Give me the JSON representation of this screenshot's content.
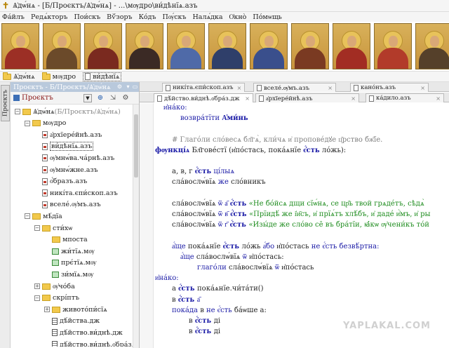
{
  "window": {
    "title": "Ѧ҆дѡ́нѧ - [Б/Проєктъ/Ѧ҆дѡ́нѧ] - ...\\мѹдро\\ви́дѣнїѧ.азъ"
  },
  "menu": [
    "Фа́йлъ",
    "Редѧ́кторъ",
    "Пои́скъ",
    "Вѷ́зоръ",
    "Ко́дъ",
    "Пѹ́скъ",
    "Налѧ́дка",
    "О҆кно̀",
    "По́мѡщь"
  ],
  "icon_strip": [
    {
      "robe": "#9c2f25"
    },
    {
      "robe": "#6b4a2a"
    },
    {
      "robe": "#7a2a1f"
    },
    {
      "robe": "#3b2a25"
    },
    {
      "robe": "#4f6aa8"
    },
    {
      "robe": "#2f3f6a"
    },
    {
      "robe": "#3a4f8c"
    },
    {
      "robe": "#7a3a22"
    },
    {
      "robe": "#a22d23"
    },
    {
      "robe": "#b23b2a"
    },
    {
      "robe": "#55402a"
    }
  ],
  "breadcrumb": [
    {
      "label": "Ѧ҆дѡ́нѧ",
      "type": "folder"
    },
    {
      "label": "мѹдро",
      "type": "folder"
    },
    {
      "label": "ви́дѣнїѧ",
      "type": "file"
    }
  ],
  "side_tab": "Проєктъ",
  "project": {
    "header": "Проєктъ - Б/Проєктъ/Ѧ҆дѡ́нѧ",
    "selector": "Проєктъ",
    "tree": [
      {
        "label": "Ѧ҆дѡ́нѧ",
        "extra": "(Б/Проєктъ/Ѧ҆дѡ́нѧ)",
        "kind": "folder",
        "toggle": "−"
      },
      {
        "label": "мѹдро",
        "kind": "folder",
        "toggle": "−"
      },
      {
        "label": "а҆рхїере́йнѣ.азъ",
        "kind": "file"
      },
      {
        "label": "ви́дѣнїѧ.азъ",
        "kind": "file",
        "selected": true
      },
      {
        "label": "ѹ҆мнѡ́ва.ча́рнѣ.азъ",
        "kind": "file"
      },
      {
        "label": "ѹ҆мнѡ́жне.азъ",
        "kind": "file"
      },
      {
        "label": "о҆́бразъ.азъ",
        "kind": "file"
      },
      {
        "label": "никі́та.єпи́скоп.азъ",
        "kind": "file"
      },
      {
        "label": "вселе́.ѹ҆мъ.азъ",
        "kind": "file"
      },
      {
        "label": "мѣ́дїа",
        "kind": "folder",
        "toggle": "−"
      },
      {
        "label": "сти́хѡ",
        "kind": "folder",
        "toggle": "−"
      },
      {
        "label": "мпоста",
        "kind": "folder"
      },
      {
        "label": "жи́тїѧ.мѹ",
        "kind": "image"
      },
      {
        "label": "прє́тїѧ.мѹ",
        "kind": "image"
      },
      {
        "label": "зи́мїѧ.мѹ",
        "kind": "image"
      },
      {
        "label": "ѹ҆чо́ба",
        "kind": "folder",
        "toggle": "+"
      },
      {
        "label": "скрі́птъ",
        "kind": "folder",
        "toggle": "−"
      },
      {
        "label": "живото́пи́сїѧ",
        "kind": "folder",
        "toggle": "+"
      },
      {
        "label": "дѣ́йства.дж",
        "kind": "doc"
      },
      {
        "label": "дѣ́йство.ви́днѣ.дж",
        "kind": "doc"
      },
      {
        "label": "дѣ́йство.ви́днѣ.о҆бра́з.дж",
        "kind": "doc"
      },
      {
        "label": "є҆вїо.дѣ́йства.дж",
        "kind": "doc"
      }
    ]
  },
  "tabs_row1": [
    {
      "label": "никі́та.єпи́скоп.азъ"
    },
    {
      "label": "вселе́.ѹ҆мъ.азъ"
    },
    {
      "label": "кано́нъ.азъ"
    }
  ],
  "tabs_row2": [
    {
      "label": "дѣ́йство.ви́днѣ.о҆бра́з.дж"
    },
    {
      "label": "а҆рхїере́йнѣ.азъ"
    },
    {
      "label": "ка́дило.азъ"
    }
  ],
  "code": [
    {
      "parts": [
        {
          "c": "kw",
          "t": "и҆на́ко:"
        }
      ],
      "indent": 2
    },
    {
      "parts": [
        {
          "c": "kw",
          "t": "возвра́тїти "
        },
        {
          "c": "kwb",
          "t": "А҆ми́нь"
        }
      ],
      "indent": 6
    },
    {
      "parts": [],
      "indent": 0
    },
    {
      "parts": [
        {
          "c": "cmt",
          "t": "# Глаго́ли сло́весѧ бл҃гѧ̀, кли́чѧ и҆ пропове́дꙋе ц҃рство бж҃їе."
        }
      ],
      "indent": 4
    },
    {
      "parts": [
        {
          "c": "kwb",
          "t": "фѹнкці́ѧ "
        },
        {
          "c": "txt",
          "t": "Бл҃гове́стї (и҆по́стась, пока́ѧнїе "
        },
        {
          "c": "kwb",
          "t": "є҆́сть"
        },
        {
          "c": "txt",
          "t": " ло́жь):"
        }
      ],
      "indent": 0
    },
    {
      "parts": [],
      "indent": 0
    },
    {
      "parts": [
        {
          "c": "txt",
          "t": "а, в, г "
        },
        {
          "c": "kwb",
          "t": "є҆́сть"
        },
        {
          "c": "kw",
          "t": " ці́лыѧ"
        }
      ],
      "indent": 4
    },
    {
      "parts": [
        {
          "c": "txt",
          "t": "сла́вослѡ́вїѧ "
        },
        {
          "c": "kw",
          "t": "же "
        },
        {
          "c": "txt",
          "t": "сло́вникъ"
        }
      ],
      "indent": 4
    },
    {
      "parts": [],
      "indent": 0
    },
    {
      "parts": [
        {
          "c": "txt",
          "t": "сла́вослѡ́вїѧ "
        },
        {
          "c": "kw",
          "t": "ѿ "
        },
        {
          "c": "num",
          "t": "а҃ "
        },
        {
          "c": "kwb",
          "t": "є҆́сть "
        },
        {
          "c": "str",
          "t": "«Не бо́йсѧ дщи сїѡ́нѧ, се цр҃ь твой грѧде́тъ, сѣдѧ̀"
        }
      ],
      "indent": 4
    },
    {
      "parts": [
        {
          "c": "txt",
          "t": "сла́вослѡ́вїѧ "
        },
        {
          "c": "kw",
          "t": "ѿ "
        },
        {
          "c": "num",
          "t": "в҃ "
        },
        {
          "c": "kwb",
          "t": "є҆́сть "
        },
        {
          "c": "str",
          "t": "«Прїидѣ́ же і҆и҃съ, и҆ прїѧ́тъ хлѣ́бъ, и҆ даде́ и҆̀мъ, и҆ ры"
        }
      ],
      "indent": 4
    },
    {
      "parts": [
        {
          "c": "txt",
          "t": "сла́вослѡ́вїѧ "
        },
        {
          "c": "kw",
          "t": "ѿ "
        },
        {
          "c": "num",
          "t": "г҃ "
        },
        {
          "c": "kwb",
          "t": "є҆́сть "
        },
        {
          "c": "str",
          "t": "«Изы́де же сло́во се̑ въ бра́тїи, ꙗ҆́кѡ ѹ҆чени́къ то́й"
        }
      ],
      "indent": 4
    },
    {
      "parts": [],
      "indent": 0
    },
    {
      "parts": [
        {
          "c": "kw",
          "t": "а҆́ще "
        },
        {
          "c": "txt",
          "t": "пока́ѧнїе "
        },
        {
          "c": "kwb",
          "t": "є҆́сть "
        },
        {
          "c": "txt",
          "t": "ло́жь "
        },
        {
          "c": "kw",
          "t": "а҆́бо "
        },
        {
          "c": "txt",
          "t": "и҆по́стась "
        },
        {
          "c": "kw",
          "t": "не є҆́сть безвѣ́ртна:"
        }
      ],
      "indent": 4
    },
    {
      "parts": [
        {
          "c": "kw",
          "t": "а҆́ще "
        },
        {
          "c": "txt",
          "t": "сла́вослѡ́вїѧ "
        },
        {
          "c": "kw",
          "t": "ѿ "
        },
        {
          "c": "txt",
          "t": "и҆по́стась:"
        }
      ],
      "indent": 6
    },
    {
      "parts": [
        {
          "c": "kw",
          "t": "глаго́ли "
        },
        {
          "c": "txt",
          "t": "сла́вослѡ́вїѧ "
        },
        {
          "c": "kw",
          "t": "ѿ "
        },
        {
          "c": "txt",
          "t": "и҆по́стась"
        }
      ],
      "indent": 10
    },
    {
      "parts": [
        {
          "c": "kw",
          "t": "и҆на́ко:"
        }
      ],
      "indent": 0
    },
    {
      "parts": [
        {
          "c": "txt",
          "t": "а "
        },
        {
          "c": "kwb",
          "t": "є҆́сть "
        },
        {
          "c": "txt",
          "t": "пока́ѧнїе.чи́та́ти()"
        }
      ],
      "indent": 4
    },
    {
      "parts": [
        {
          "c": "txt",
          "t": "в "
        },
        {
          "c": "kwb",
          "t": "є҆́сть "
        },
        {
          "c": "num",
          "t": "а҃"
        }
      ],
      "indent": 4
    },
    {
      "parts": [
        {
          "c": "kw",
          "t": "пока́да "
        },
        {
          "c": "txt",
          "t": "в "
        },
        {
          "c": "kw",
          "t": "не є҆́сть "
        },
        {
          "c": "txt",
          "t": "ба́ѡше а:"
        }
      ],
      "indent": 4
    },
    {
      "parts": [
        {
          "c": "txt",
          "t": "в "
        },
        {
          "c": "kwb",
          "t": "є҆́сть "
        },
        {
          "c": "txt",
          "t": "ді"
        }
      ],
      "indent": 8
    },
    {
      "parts": [
        {
          "c": "txt",
          "t": "в "
        },
        {
          "c": "kwb",
          "t": "є҆́сть "
        },
        {
          "c": "txt",
          "t": "ді"
        }
      ],
      "indent": 8
    }
  ],
  "watermark": "YAPLAKAL.COM"
}
